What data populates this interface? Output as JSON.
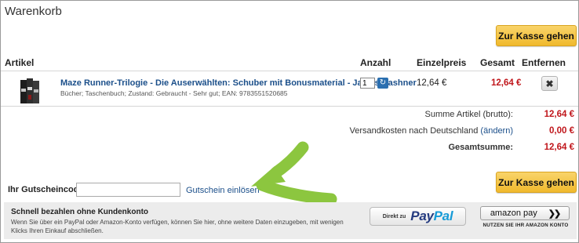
{
  "cart": {
    "title": "Warenkorb",
    "checkout_label": "Zur Kasse gehen"
  },
  "table": {
    "headers": {
      "article": "Artikel",
      "quantity": "Anzahl",
      "unit_price": "Einzelpreis",
      "total": "Gesamt",
      "remove": "Entfernen"
    },
    "items": [
      {
        "title": "Maze Runner-Trilogie - Die Auserwählten: Schuber mit Bonusmaterial - James Dashner",
        "meta": "Bücher; Taschenbuch; Zustand: Gebraucht - Sehr gut; EAN: 9783551520685",
        "quantity": "1",
        "unit_price": "12,64 €",
        "total": "12,64 €",
        "remove_icon": "close-icon"
      }
    ]
  },
  "summary": {
    "subtotal_label": "Summe Artikel (brutto):",
    "subtotal_value": "12,64 €",
    "shipping_label": "Versandkosten nach Deutschland",
    "shipping_link": "(ändern)",
    "shipping_value": "0,00 €",
    "grand_total_label": "Gesamtsumme:",
    "grand_total_value": "12,64 €"
  },
  "coupon": {
    "label": "Ihr Gutscheincode:",
    "value": "",
    "redeem_label": "Gutschein einlösen"
  },
  "express": {
    "title": "Schnell bezahlen ohne Kundenkonto",
    "description": "Wenn Sie über ein PayPal oder Amazon-Konto verfügen, können Sie hier, ohne weitere Daten einzugeben, mit wenigen Klicks Ihren Einkauf abschließen.",
    "paypal_prefix": "Direkt zu",
    "paypal_part1": "Pay",
    "paypal_part2": "Pal",
    "amazon_label": "amazon pay",
    "amazon_note": "NUTZEN SIE IHR AMAZON KONTO"
  },
  "colors": {
    "accent_button": "#f0b92d",
    "price_red": "#c0161b",
    "link_blue": "#1b4f8a",
    "annotation_arrow": "#8cc63f"
  }
}
